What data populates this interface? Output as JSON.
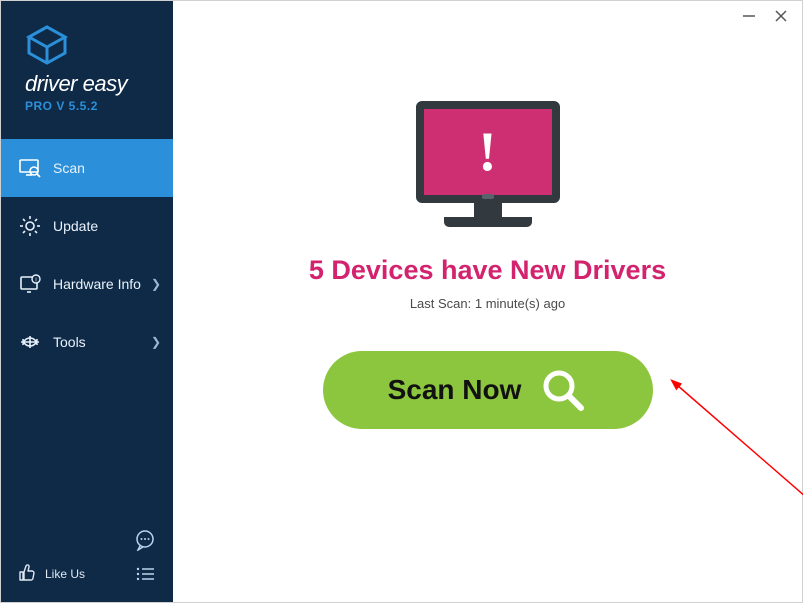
{
  "brand": {
    "name": "driver easy",
    "version": "PRO V 5.5.2"
  },
  "nav": {
    "scan": "Scan",
    "update": "Update",
    "hardware": "Hardware Info",
    "tools": "Tools"
  },
  "sidebar_bottom": {
    "like_us": "Like Us"
  },
  "main": {
    "headline": "5 Devices have New Drivers",
    "last_scan": "Last Scan: 1 minute(s) ago",
    "scan_button": "Scan Now"
  },
  "colors": {
    "sidebar_bg": "#0e2a47",
    "accent": "#2b8fd9",
    "headline": "#d3236e",
    "scan_btn": "#8cc63e",
    "monitor_screen": "#ce2f72"
  }
}
